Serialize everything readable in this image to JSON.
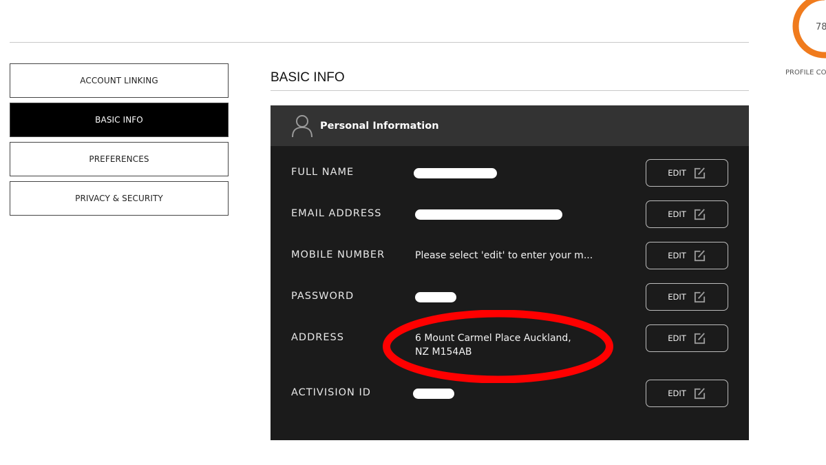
{
  "sidebar": {
    "items": [
      {
        "label": "ACCOUNT LINKING",
        "active": false
      },
      {
        "label": "BASIC INFO",
        "active": true
      },
      {
        "label": "PREFERENCES",
        "active": false
      },
      {
        "label": "PRIVACY & SECURITY",
        "active": false
      }
    ]
  },
  "main": {
    "title": "BASIC INFO",
    "panel": {
      "title": "Personal Information",
      "icon": "user-icon",
      "rows": [
        {
          "label": "FULL NAME",
          "value": "",
          "redacted": true
        },
        {
          "label": "EMAIL ADDRESS",
          "value": "",
          "redacted": true
        },
        {
          "label": "MOBILE NUMBER",
          "value": "Please select 'edit' to enter your m...",
          "redacted": false
        },
        {
          "label": "PASSWORD",
          "value": "",
          "redacted": true
        },
        {
          "label": "ADDRESS",
          "value_line1": "6 Mount Carmel Place Auckland,",
          "value_line2": "NZ M154AB",
          "redacted": false,
          "highlighted": true
        },
        {
          "label": "ACTIVISION ID",
          "value": "",
          "redacted": true
        }
      ],
      "edit_label": "EDIT",
      "edit_icon": "edit-icon"
    }
  },
  "profile_completion": {
    "value_text": "78",
    "percent": 78,
    "label": "PROFILE CO",
    "ring_color": "#f07b1d",
    "track_color": "#eeeeee"
  },
  "annotation": {
    "color": "#ff0000",
    "target": "address"
  }
}
